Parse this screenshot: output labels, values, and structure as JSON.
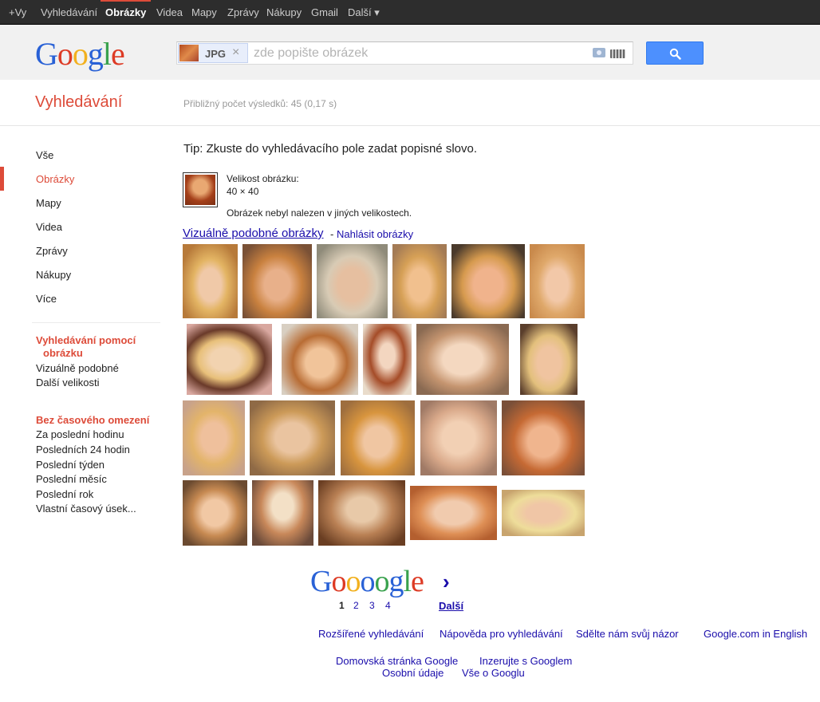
{
  "topbar": {
    "items": [
      "+Vy",
      "Vyhledávání",
      "Obrázky",
      "Videa",
      "Mapy",
      "Zprávy",
      "Nákupy",
      "Gmail",
      "Další ▾"
    ],
    "active_index": 2
  },
  "header": {
    "logo_letters": [
      "G",
      "o",
      "o",
      "g",
      "l",
      "e"
    ],
    "logo_colors": [
      "#2961d6",
      "#dd3b25",
      "#f2b01e",
      "#2961d6",
      "#3aa24e",
      "#dd3b25"
    ],
    "chip_label": "JPG",
    "chip_close": "×",
    "search_placeholder": "zde popište obrázek",
    "search_value": ""
  },
  "title_row": {
    "title": "Vyhledávání",
    "stats": "Přibližný počet výsledků: 45 (0,17 s)"
  },
  "leftnav": {
    "items": [
      "Vše",
      "Obrázky",
      "Mapy",
      "Videa",
      "Zprávy",
      "Nákupy",
      "Více"
    ],
    "selected_index": 1,
    "section1_heading_line1": "Vyhledávání pomocí",
    "section1_heading_line2": "obrázku",
    "section1_items": [
      "Vizuálně podobné",
      "Další velikosti"
    ],
    "section2_heading": "Bez časového omezení",
    "section2_items": [
      "Za poslední hodinu",
      "Posledních 24 hodin",
      "Poslední týden",
      "Poslední měsíc",
      "Poslední rok",
      "Vlastní časový úsek..."
    ]
  },
  "main": {
    "tip": "Tip: Zkuste do vyhledávacího pole zadat popisné slovo.",
    "size_label": "Velikost obrázku:",
    "size_value": "40 × 40",
    "not_found": "Obrázek nebyl nalezen v jiných velikostech.",
    "similar_link": "Vizuálně podobné obrázky",
    "report_dash": "-",
    "report_link": "Nahlásit obrázky"
  },
  "pagination": {
    "logo_letters": [
      "G",
      "o",
      "o",
      "o",
      "o",
      "g",
      "l",
      "e"
    ],
    "logo_colors": [
      "#2961d6",
      "#dd3b25",
      "#f2b01e",
      "#2961d6",
      "#3aa24e",
      "#2961d6",
      "#3aa24e",
      "#dd3b25"
    ],
    "arrow": "›",
    "pages": [
      "1",
      "2",
      "3",
      "4"
    ],
    "current_page": "1",
    "next_label": "Další"
  },
  "footer": {
    "row1": [
      "Rozšířené vyhledávání",
      "Nápověda pro vyhledávání",
      "Sdělte nám svůj názor",
      "Google.com in English"
    ],
    "row2": [
      "Domovská stránka Google",
      "Inzerujte s Googlem"
    ],
    "row3": [
      "Osobní údaje",
      "Vše o Googlu"
    ]
  },
  "colors": {
    "accent_red": "#dd4b39",
    "link_blue": "#1a0dab",
    "search_button_blue": "#4d90fe",
    "topbar_bg": "#2d2d2d"
  }
}
